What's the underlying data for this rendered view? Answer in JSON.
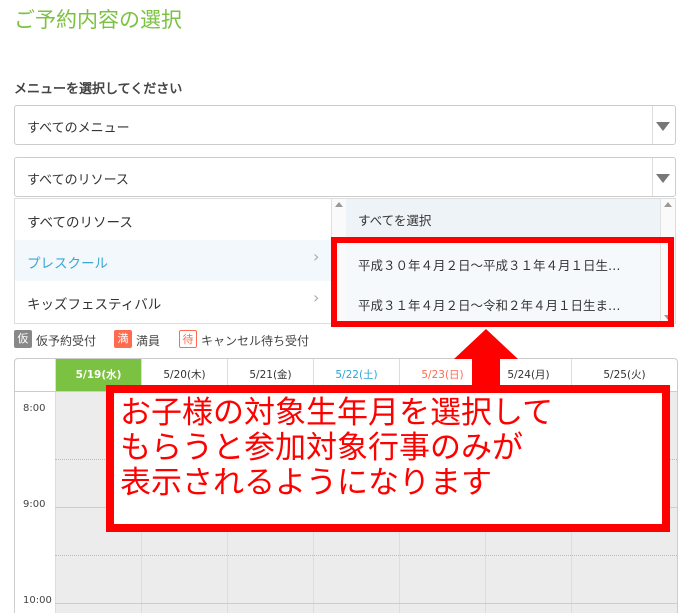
{
  "page": {
    "title": "ご予約内容の選択"
  },
  "menu": {
    "label": "メニューを選択してください",
    "menu_select": "すべてのメニュー",
    "resource_select": "すべてのリソース"
  },
  "dropdown": {
    "left_items": [
      "すべてのリソース",
      "プレスクール",
      "キッズフェスティバル"
    ],
    "right_items": [
      "すべてを選択",
      "平成３０年４月２日～平成３１年４月１日生…",
      "平成３１年４月２日～令和２年４月１日生ま…"
    ]
  },
  "legend": {
    "tentative": "仮予約受付",
    "tentative_badge": "仮",
    "full": "満員",
    "full_badge": "満",
    "waitlist": "キャンセル待ち受付",
    "waitlist_badge": "待"
  },
  "calendar": {
    "days": [
      "5/19(水)",
      "5/20(木)",
      "5/21(金)",
      "5/22(土)",
      "5/23(日)",
      "5/24(月)",
      "5/25(火)"
    ],
    "times": [
      "8:00",
      "9:00",
      "10:00"
    ]
  },
  "callout": {
    "line1": "お子様の対象生年月を選択して",
    "line2": "もらうと参加対象行事のみが",
    "line3": "表示されるようになります"
  },
  "colors": {
    "accent": "#7cc242",
    "link": "#3ea6d5",
    "saturday": "#2aa5d8",
    "sunday": "#ff6b4f",
    "annotation": "#ff0000"
  }
}
